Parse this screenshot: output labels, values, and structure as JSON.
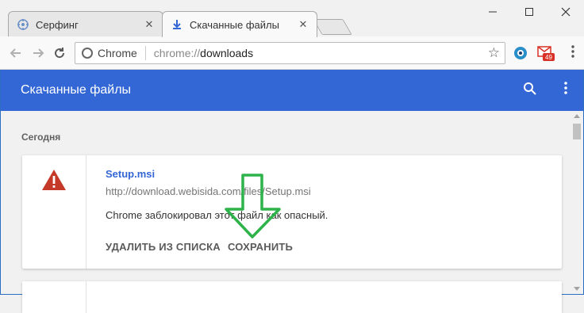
{
  "tabs": [
    {
      "title": "Серфинг",
      "icon": "surfing-site-icon",
      "active": false
    },
    {
      "title": "Скачанные файлы",
      "icon": "download-icon",
      "active": true
    }
  ],
  "toolbar": {
    "scheme_label": "Chrome",
    "url_prefix": "chrome://",
    "url_host": "downloads",
    "mail_badge": "49"
  },
  "header": {
    "title": "Скачанные файлы"
  },
  "downloads": {
    "date_label": "Сегодня",
    "item": {
      "file_name": "Setup.msi",
      "url": "http://download.webisida.com/files/Setup.msi",
      "status": "Chrome заблокировал этот файл как опасный.",
      "remove_label": "УДАЛИТЬ ИЗ СПИСКА",
      "save_label": "СОХРАНИТЬ"
    }
  },
  "colors": {
    "header_bg": "#3367d6",
    "link": "#3367d6",
    "warning": "#c53929",
    "annotation": "#2db34a"
  }
}
